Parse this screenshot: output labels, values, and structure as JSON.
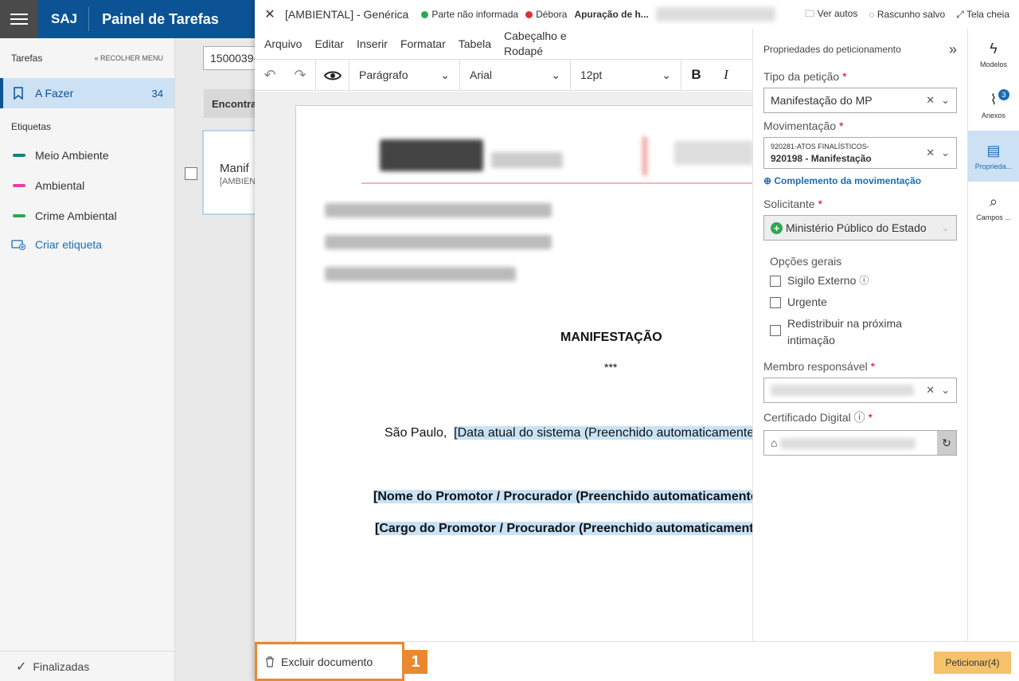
{
  "app": {
    "brand": "SAJ",
    "title": "Painel de Tarefas"
  },
  "sidebar": {
    "section": "Tarefas",
    "collapse": "RECOLHER MENU",
    "afazer": {
      "label": "A Fazer",
      "count": "34"
    },
    "labels_title": "Etiquetas",
    "tags": [
      {
        "label": "Meio Ambiente",
        "color": "#16807a"
      },
      {
        "label": "Ambiental",
        "color": "#e83ea8"
      },
      {
        "label": "Crime Ambiental",
        "color": "#2ea84f"
      }
    ],
    "create": "Criar etiqueta",
    "finalizadas": "Finalizadas"
  },
  "list": {
    "search_value": "1500039-",
    "header": "Encontra",
    "card_title": "Manif",
    "card_sub": "[AMBIEN"
  },
  "editor": {
    "doc_title": "[AMBIENTAL] - Genérica",
    "status1": "Parte não informada",
    "status2": "Débora",
    "apuracao": "Apuração de h...",
    "ver_autos": "Ver autos",
    "rascunho": "Rascunho salvo",
    "tela_cheia": "Tela cheia",
    "menu": [
      "Arquivo",
      "Editar",
      "Inserir",
      "Formatar",
      "Tabela"
    ],
    "menu_cab1": "Cabeçalho e",
    "menu_cab2": "Rodapé",
    "style": "Parágrafo",
    "font": "Arial",
    "size": "12pt",
    "doc": {
      "heading": "MANIFESTAÇÃO",
      "stars": "***",
      "city": "São Paulo,",
      "date_field": "[Data atual do sistema (Preenchido automaticamente",
      "name_field": "[Nome do Promotor / Procurador (Preenchido automaticamente",
      "role_field": "[Cargo do Promotor / Procurador (Preenchido automaticament"
    }
  },
  "props": {
    "title": "Propriedades do peticionamento",
    "tipo_label": "Tipo da petição",
    "tipo_value": "Manifestação do MP",
    "mov_label": "Movimentação",
    "mov_line1": "920281-ATOS FINALÍSTICOS-",
    "mov_line2": "920198 - Manifestação",
    "complemento": "Complemento da movimentação",
    "solic_label": "Solicitante",
    "solic_value": "Ministério Público do Estado",
    "opcoes": "Opções gerais",
    "opt1": "Sigilo Externo",
    "opt2": "Urgente",
    "opt3": "Redistribuir na próxima intimação",
    "membro_label": "Membro responsável",
    "cert_label": "Certificado Digital"
  },
  "rail": [
    {
      "label": "Modelos",
      "icon": "bolt-icon"
    },
    {
      "label": "Anexos",
      "icon": "paperclip-icon",
      "badge": "3"
    },
    {
      "label": "Proprieda...",
      "icon": "document-icon"
    },
    {
      "label": "Campos ...",
      "icon": "doc-search-icon"
    }
  ],
  "footer": {
    "delete": "Excluir documento",
    "step": "1",
    "submit": "Peticionar(4)"
  }
}
